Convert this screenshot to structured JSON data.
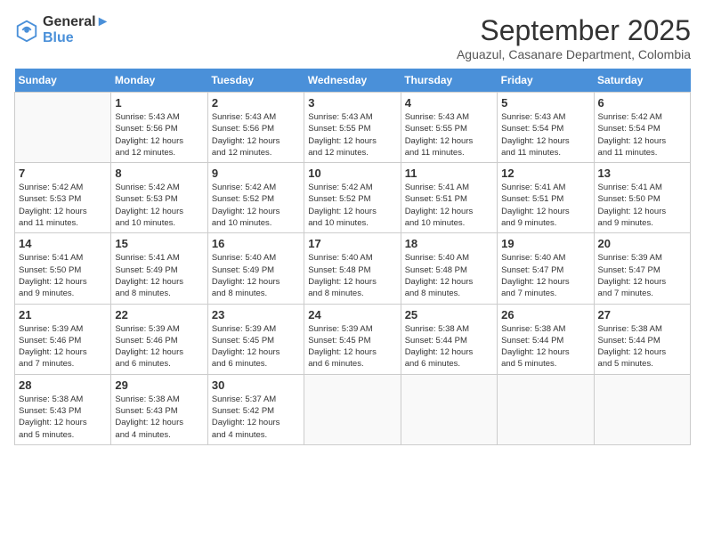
{
  "logo": {
    "line1": "General",
    "line2": "Blue"
  },
  "title": "September 2025",
  "subtitle": "Aguazul, Casanare Department, Colombia",
  "days_header": [
    "Sunday",
    "Monday",
    "Tuesday",
    "Wednesday",
    "Thursday",
    "Friday",
    "Saturday"
  ],
  "weeks": [
    [
      {
        "day": "",
        "info": ""
      },
      {
        "day": "1",
        "info": "Sunrise: 5:43 AM\nSunset: 5:56 PM\nDaylight: 12 hours\nand 12 minutes."
      },
      {
        "day": "2",
        "info": "Sunrise: 5:43 AM\nSunset: 5:56 PM\nDaylight: 12 hours\nand 12 minutes."
      },
      {
        "day": "3",
        "info": "Sunrise: 5:43 AM\nSunset: 5:55 PM\nDaylight: 12 hours\nand 12 minutes."
      },
      {
        "day": "4",
        "info": "Sunrise: 5:43 AM\nSunset: 5:55 PM\nDaylight: 12 hours\nand 11 minutes."
      },
      {
        "day": "5",
        "info": "Sunrise: 5:43 AM\nSunset: 5:54 PM\nDaylight: 12 hours\nand 11 minutes."
      },
      {
        "day": "6",
        "info": "Sunrise: 5:42 AM\nSunset: 5:54 PM\nDaylight: 12 hours\nand 11 minutes."
      }
    ],
    [
      {
        "day": "7",
        "info": "Sunrise: 5:42 AM\nSunset: 5:53 PM\nDaylight: 12 hours\nand 11 minutes."
      },
      {
        "day": "8",
        "info": "Sunrise: 5:42 AM\nSunset: 5:53 PM\nDaylight: 12 hours\nand 10 minutes."
      },
      {
        "day": "9",
        "info": "Sunrise: 5:42 AM\nSunset: 5:52 PM\nDaylight: 12 hours\nand 10 minutes."
      },
      {
        "day": "10",
        "info": "Sunrise: 5:42 AM\nSunset: 5:52 PM\nDaylight: 12 hours\nand 10 minutes."
      },
      {
        "day": "11",
        "info": "Sunrise: 5:41 AM\nSunset: 5:51 PM\nDaylight: 12 hours\nand 10 minutes."
      },
      {
        "day": "12",
        "info": "Sunrise: 5:41 AM\nSunset: 5:51 PM\nDaylight: 12 hours\nand 9 minutes."
      },
      {
        "day": "13",
        "info": "Sunrise: 5:41 AM\nSunset: 5:50 PM\nDaylight: 12 hours\nand 9 minutes."
      }
    ],
    [
      {
        "day": "14",
        "info": "Sunrise: 5:41 AM\nSunset: 5:50 PM\nDaylight: 12 hours\nand 9 minutes."
      },
      {
        "day": "15",
        "info": "Sunrise: 5:41 AM\nSunset: 5:49 PM\nDaylight: 12 hours\nand 8 minutes."
      },
      {
        "day": "16",
        "info": "Sunrise: 5:40 AM\nSunset: 5:49 PM\nDaylight: 12 hours\nand 8 minutes."
      },
      {
        "day": "17",
        "info": "Sunrise: 5:40 AM\nSunset: 5:48 PM\nDaylight: 12 hours\nand 8 minutes."
      },
      {
        "day": "18",
        "info": "Sunrise: 5:40 AM\nSunset: 5:48 PM\nDaylight: 12 hours\nand 8 minutes."
      },
      {
        "day": "19",
        "info": "Sunrise: 5:40 AM\nSunset: 5:47 PM\nDaylight: 12 hours\nand 7 minutes."
      },
      {
        "day": "20",
        "info": "Sunrise: 5:39 AM\nSunset: 5:47 PM\nDaylight: 12 hours\nand 7 minutes."
      }
    ],
    [
      {
        "day": "21",
        "info": "Sunrise: 5:39 AM\nSunset: 5:46 PM\nDaylight: 12 hours\nand 7 minutes."
      },
      {
        "day": "22",
        "info": "Sunrise: 5:39 AM\nSunset: 5:46 PM\nDaylight: 12 hours\nand 6 minutes."
      },
      {
        "day": "23",
        "info": "Sunrise: 5:39 AM\nSunset: 5:45 PM\nDaylight: 12 hours\nand 6 minutes."
      },
      {
        "day": "24",
        "info": "Sunrise: 5:39 AM\nSunset: 5:45 PM\nDaylight: 12 hours\nand 6 minutes."
      },
      {
        "day": "25",
        "info": "Sunrise: 5:38 AM\nSunset: 5:44 PM\nDaylight: 12 hours\nand 6 minutes."
      },
      {
        "day": "26",
        "info": "Sunrise: 5:38 AM\nSunset: 5:44 PM\nDaylight: 12 hours\nand 5 minutes."
      },
      {
        "day": "27",
        "info": "Sunrise: 5:38 AM\nSunset: 5:44 PM\nDaylight: 12 hours\nand 5 minutes."
      }
    ],
    [
      {
        "day": "28",
        "info": "Sunrise: 5:38 AM\nSunset: 5:43 PM\nDaylight: 12 hours\nand 5 minutes."
      },
      {
        "day": "29",
        "info": "Sunrise: 5:38 AM\nSunset: 5:43 PM\nDaylight: 12 hours\nand 4 minutes."
      },
      {
        "day": "30",
        "info": "Sunrise: 5:37 AM\nSunset: 5:42 PM\nDaylight: 12 hours\nand 4 minutes."
      },
      {
        "day": "",
        "info": ""
      },
      {
        "day": "",
        "info": ""
      },
      {
        "day": "",
        "info": ""
      },
      {
        "day": "",
        "info": ""
      }
    ]
  ]
}
